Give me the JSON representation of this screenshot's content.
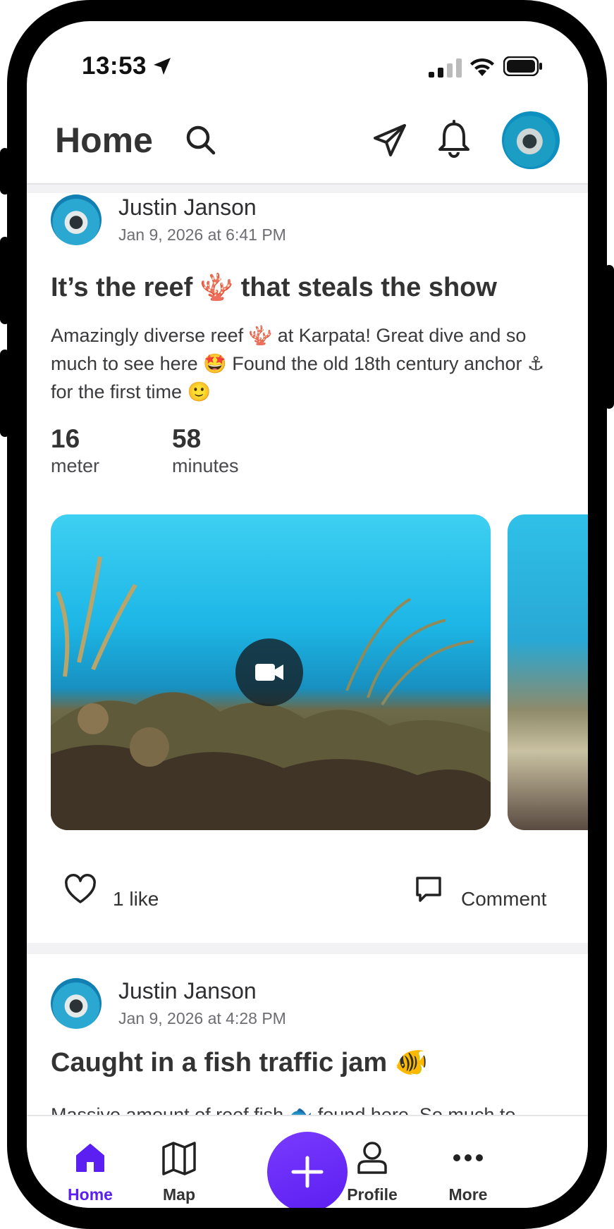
{
  "status_bar": {
    "time": "13:53"
  },
  "header": {
    "title": "Home"
  },
  "posts": [
    {
      "author": "Justin Janson",
      "date": "Jan 9, 2026 at 6:41 PM",
      "title": "It’s the reef 🪸 that steals the show",
      "body": "Amazingly diverse reef 🪸 at Karpata! Great dive and so much to see here 🤩 Found the old 18th century anchor ⚓ for the first time 🙂",
      "stats": [
        {
          "value": "16",
          "label": "meter"
        },
        {
          "value": "58",
          "label": "minutes"
        }
      ],
      "likes_label": "1 like",
      "comment_label": "Comment"
    },
    {
      "author": "Justin Janson",
      "date": "Jan 9, 2026 at 4:28 PM",
      "title": "Caught in a fish traffic jam 🐠",
      "body_preview": "Massive amount of reef fish 🐟 found here. So much to"
    }
  ],
  "bottom_nav": {
    "items": [
      {
        "label": "Home",
        "icon": "home-icon",
        "active": true
      },
      {
        "label": "Map",
        "icon": "map-icon",
        "active": false
      },
      {
        "label": "Profile",
        "icon": "profile-icon",
        "active": false
      },
      {
        "label": "More",
        "icon": "more-icon",
        "active": false
      }
    ]
  },
  "colors": {
    "accent": "#5b1ff2",
    "text": "#333333",
    "muted": "#6d6d72"
  }
}
